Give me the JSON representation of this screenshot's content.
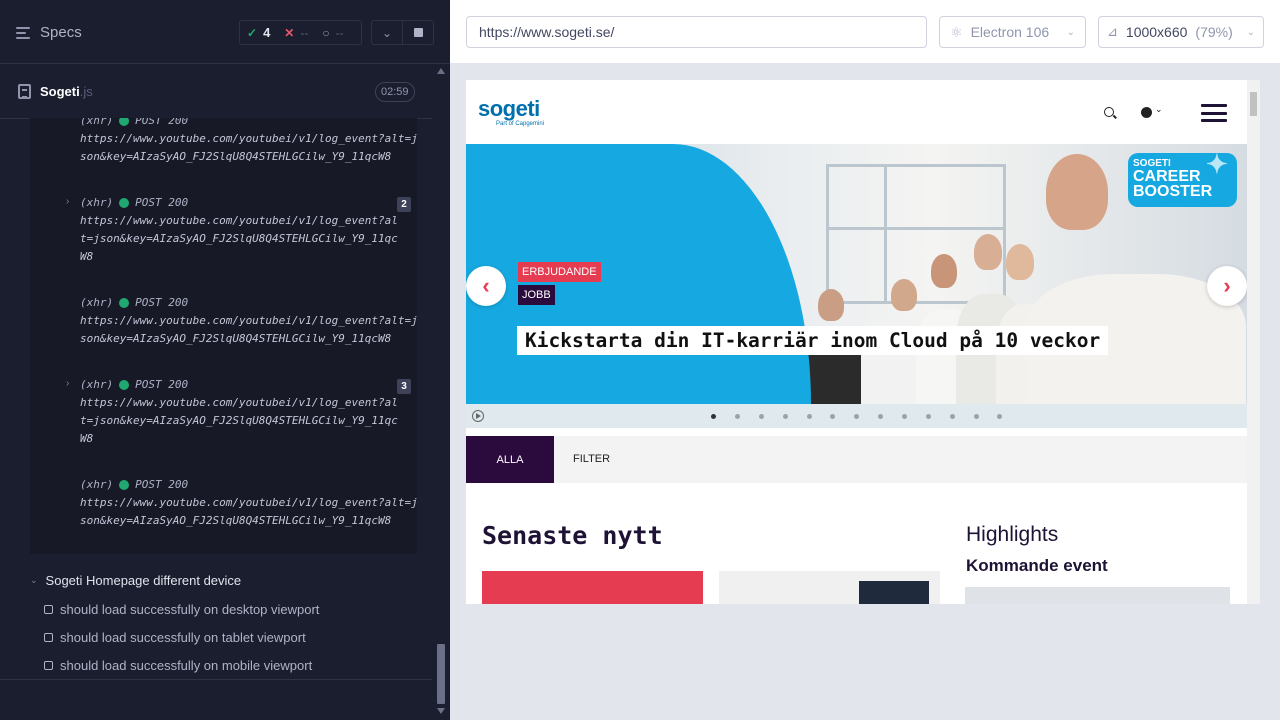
{
  "runner": {
    "specs_label": "Specs",
    "passed": "4",
    "failed": "--",
    "pending": "--",
    "file": {
      "name": "Sogeti",
      "ext": ".js",
      "duration": "02:59"
    },
    "logs": [
      {
        "type": "(xhr)",
        "method": "POST 200",
        "url": "https://www.youtube.com/youtubei/v1/log_event?alt=json&key=AIzaSyAO_FJ2SlqU8Q4STEHLGCilw_Y9_11qcW8",
        "count": ""
      },
      {
        "type": "(xhr)",
        "method": "POST 200",
        "url": "https://www.youtube.com/youtubei/v1/log_event?alt=json&key=AIzaSyAO_FJ2SlqU8Q4STEHLGCilw_Y9_11qcW8",
        "count": "2"
      },
      {
        "type": "(xhr)",
        "method": "POST 200",
        "url": "https://www.youtube.com/youtubei/v1/log_event?alt=json&key=AIzaSyAO_FJ2SlqU8Q4STEHLGCilw_Y9_11qcW8",
        "count": ""
      },
      {
        "type": "(xhr)",
        "method": "POST 200",
        "url": "https://www.youtube.com/youtubei/v1/log_event?alt=json&key=AIzaSyAO_FJ2SlqU8Q4STEHLGCilw_Y9_11qcW8",
        "count": "3"
      },
      {
        "type": "(xhr)",
        "method": "POST 200",
        "url": "https://www.youtube.com/youtubei/v1/log_event?alt=json&key=AIzaSyAO_FJ2SlqU8Q4STEHLGCilw_Y9_11qcW8",
        "count": ""
      }
    ],
    "suite": "Sogeti Homepage different device",
    "tests": [
      "should load successfully on desktop viewport",
      "should load successfully on tablet viewport",
      "should load successfully on mobile viewport"
    ]
  },
  "browser": {
    "url": "https://www.sogeti.se/",
    "name": "Electron 106",
    "viewport": "1000x660",
    "zoom": "(79%)"
  },
  "site": {
    "logo": "sogeti",
    "logo_sub": "Part of Capgemini",
    "hero": {
      "tag_offer": "ERBJUDANDE",
      "tag_job": "JOBB",
      "title": "Kickstarta din IT-karriär inom Cloud på 10 veckor",
      "badge_small": "SOGETI",
      "badge_line1": "CAREER",
      "badge_line2": "BOOSTER",
      "prev": "‹",
      "next": "›"
    },
    "tabs": {
      "all": "ALLA",
      "filter": "FILTER"
    },
    "news_title": "Senaste nytt",
    "highlights": "Highlights",
    "event": "Kommande event"
  },
  "colors": {
    "runner_bg": "#1b1e2e",
    "pass": "#1fa971",
    "fail": "#e45770",
    "sogeti_blue": "#0070ad",
    "hero_blue": "#16a9e1",
    "accent_red": "#e63c52",
    "deep_purple": "#2b0a3d"
  }
}
